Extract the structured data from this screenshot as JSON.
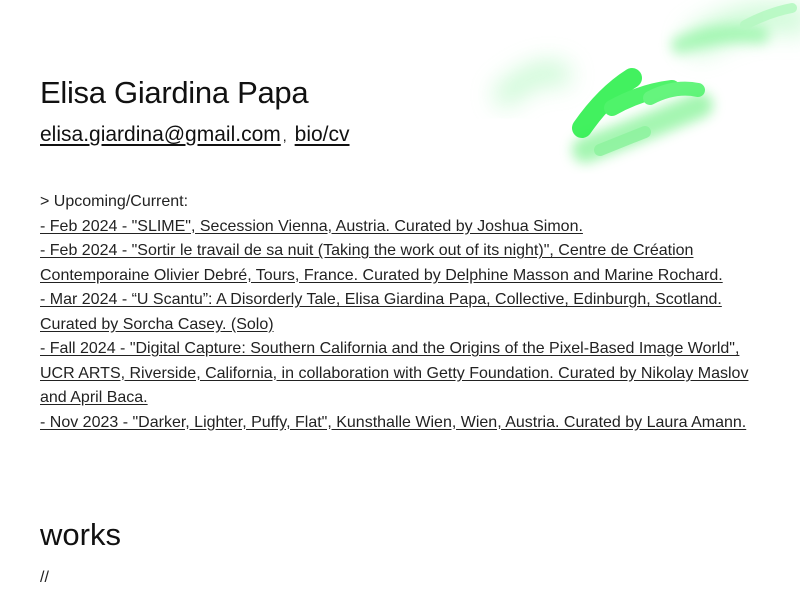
{
  "profile": {
    "name": "Elisa Giardina Papa",
    "email": "elisa.giardina@gmail.com",
    "separator": ",",
    "bio_link": "bio/cv"
  },
  "upcoming": {
    "heading": "> Upcoming/Current:",
    "items": [
      "- Feb 2024 - \"SLIME\", Secession Vienna, Austria. Curated by Joshua Simon.",
      "- Feb 2024 - \"Sortir le travail de sa nuit (Taking the work out of its night)\", Centre de Création Contemporaine Olivier Debré, Tours, France. Curated by Delphine Masson and Marine Rochard.",
      "- Mar 2024 - “U Scantu”: A Disorderly Tale, Elisa Giardina Papa, Collective, Edinburgh, Scotland. Curated by Sorcha Casey. (Solo)",
      "- Fall 2024 - \"Digital Capture: Southern California and the Origins of the Pixel-Based Image World\", UCR ARTS, Riverside, California, in collaboration with Getty Foundation. Curated by Nikolay Maslov and April Baca.",
      "- Nov 2023 - \"Darker, Lighter, Puffy, Flat\", Kunsthalle Wien, Wien, Austria. Curated by Laura Amann."
    ]
  },
  "works": {
    "title": "works",
    "content": "//"
  },
  "colors": {
    "accent_green": "#22ee44",
    "text": "#111111",
    "background": "#ffffff"
  }
}
